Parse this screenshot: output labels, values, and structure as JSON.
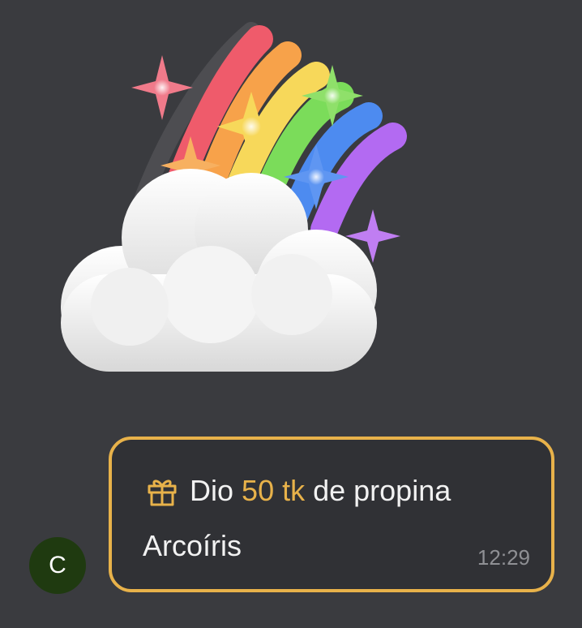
{
  "sticker": {
    "name": "rainbow-cloud-sticker",
    "colors": {
      "red": "#ef5b6b",
      "orange": "#f7a24a",
      "yellow": "#f7d85a",
      "green": "#7bdc5a",
      "blue": "#4d8bf0",
      "purple": "#b36af2",
      "cloud": "#eeeeee"
    }
  },
  "message": {
    "avatar_letter": "C",
    "tip": {
      "icon": "gift-icon",
      "prefix": "Dio",
      "amount": "50 tk",
      "suffix": "de propina",
      "gift_name": "Arcoíris",
      "time": "12:29"
    }
  },
  "colors": {
    "background": "#3a3b3f",
    "accent": "#e8b24a",
    "avatar_bg": "#1f3a10",
    "text": "#f2f2f2",
    "timestamp": "#8f9094"
  }
}
